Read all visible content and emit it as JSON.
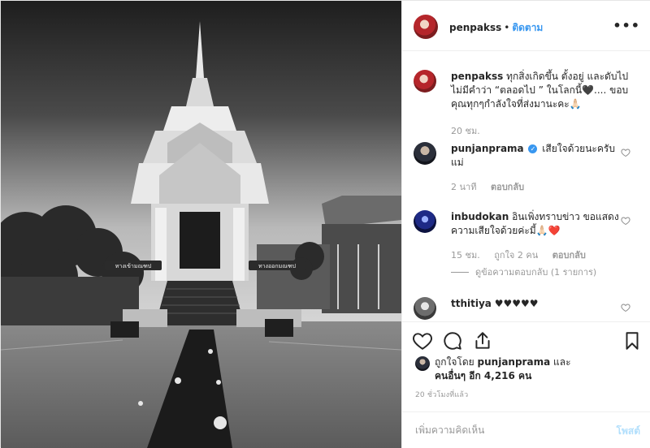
{
  "post": {
    "owner": "penpakss",
    "follow_label": "ติดตาม",
    "separator": "•",
    "more_label": "•••"
  },
  "photo": {
    "sign_left": "ทางเข้ามณฑป",
    "sign_right": "ทางออกมณฑป"
  },
  "caption": {
    "username": "penpakss",
    "text": "ทุกสิ่งเกิดขึ้น ตั้งอยู่ และดับไป ไม่มีคำว่า “ตลอดไป ” ในโลกนี้🖤.... ขอบคุณทุกๆกำลังใจที่ส่งมานะคะ🙏🏻",
    "time": "20 ชม."
  },
  "comments": [
    {
      "username": "punjanprama",
      "verified": true,
      "verified_glyph": "✓",
      "text": "เสียใจด้วยนะครับแม่",
      "time": "2 นาที",
      "reply_label": "ตอบกลับ"
    },
    {
      "username": "inbudokan",
      "verified": false,
      "text": "อินเพิ่งทราบข่าว ขอแสดงความเสียใจด้วยค่ะมี้🙏🏻❤️",
      "time": "15 ชม.",
      "likes_label": "ถูกใจ 2 คน",
      "reply_label": "ตอบกลับ",
      "view_replies": "ดูข้อความตอบกลับ (1 รายการ)"
    },
    {
      "username": "tthitiya",
      "verified": false,
      "text": "♥♥♥♥♥"
    }
  ],
  "likes": {
    "prefix": "ถูกใจโดย",
    "liker": "punjanprama",
    "and": "และ",
    "others": "คนอื่นๆ อีก 4,216 คน"
  },
  "timestamp": "20 ชั่วโมงที่แล้ว",
  "composer": {
    "placeholder": "เพิ่มความคิดเห็น",
    "post_label": "โพสต์"
  },
  "colors": {
    "link_blue": "#3897f0",
    "muted_text": "#999999",
    "post_button_disabled": "#b2dffc"
  }
}
